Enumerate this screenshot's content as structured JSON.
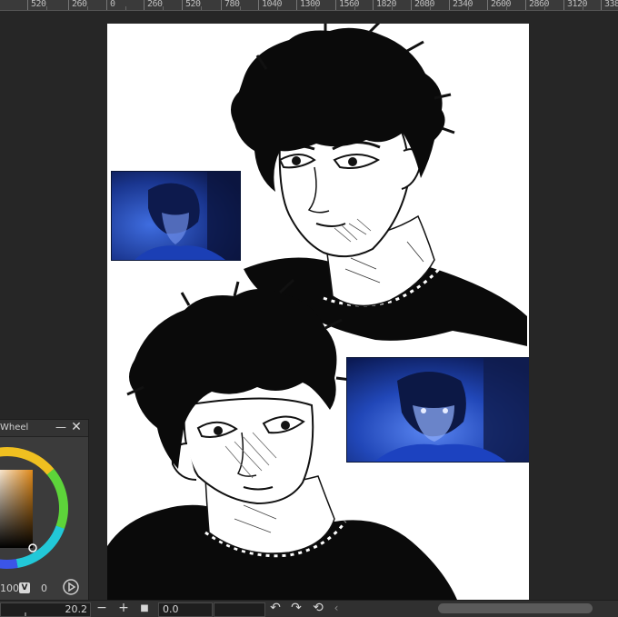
{
  "ruler": {
    "labels": [
      "520",
      "260",
      "0",
      "260",
      "520",
      "780",
      "1040",
      "1300",
      "1560",
      "1820",
      "2080",
      "2340",
      "2600",
      "2860",
      "3120",
      "338"
    ]
  },
  "color_panel": {
    "title": "Wheel",
    "minimize_glyph": "—",
    "close_glyph": "✕",
    "v_value": "100",
    "v_label": "V",
    "extra_value": "0"
  },
  "bottom_bar": {
    "zoom": "20.2",
    "zoom_out_glyph": "−",
    "zoom_in_glyph": "+",
    "fit_glyph": "■",
    "angle": "0.0",
    "rotate_left_glyph": "↶",
    "rotate_right_glyph": "↷",
    "reset_glyph": "⟲",
    "collapse_glyph": "‹"
  },
  "icons": {
    "minimize": "minimize-icon",
    "close": "close-icon",
    "play": "play-icon",
    "zoom_out": "zoom-out-icon",
    "zoom_in": "zoom-in-icon",
    "rotate_left": "rotate-left-icon",
    "rotate_right": "rotate-right-icon",
    "reset_rotation": "reset-rotation-icon"
  },
  "colors": {
    "canvas": "#ffffff",
    "workspace": "#262626",
    "selected_color": "#c0741a",
    "reference_blue": "#1a3a9a"
  }
}
